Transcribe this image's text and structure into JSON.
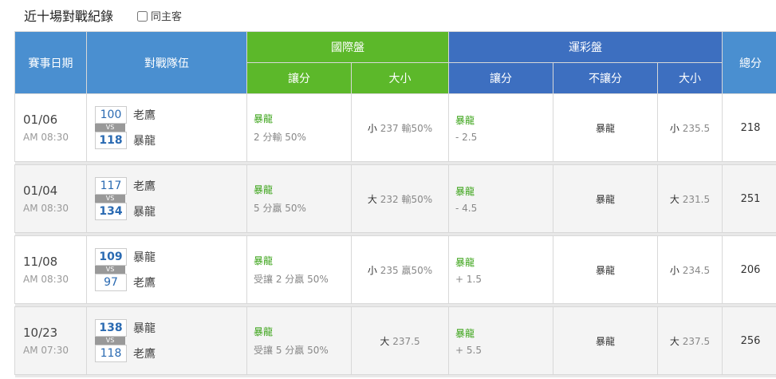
{
  "header": {
    "title": "近十場對戰紀錄",
    "checkbox_label": "同主客"
  },
  "columns": {
    "date": "賽事日期",
    "teams": "對戰隊伍",
    "intl": "國際盤",
    "lottery": "運彩盤",
    "total": "總分",
    "handicap": "讓分",
    "overunder": "大小",
    "no_handicap": "不讓分"
  },
  "vs_label": "VS",
  "rows": [
    {
      "date": "01/06",
      "time": "AM 08:30",
      "team1_score": "100",
      "team1_name": "老鷹",
      "team2_score": "118",
      "team2_name": "暴龍",
      "intl_team": "暴龍",
      "intl_sub": "2 分輸 50%",
      "intl_ou_k": "小",
      "intl_ou_v": "237  輸50%",
      "lot_team": "暴龍",
      "lot_sub": "- 2.5",
      "no_handicap": "暴龍",
      "lot_ou_k": "小",
      "lot_ou_v": "235.5",
      "total": "218"
    },
    {
      "date": "01/04",
      "time": "AM 08:30",
      "team1_score": "117",
      "team1_name": "老鷹",
      "team2_score": "134",
      "team2_name": "暴龍",
      "intl_team": "暴龍",
      "intl_sub": "5 分贏 50%",
      "intl_ou_k": "大",
      "intl_ou_v": "232  輸50%",
      "lot_team": "暴龍",
      "lot_sub": "- 4.5",
      "no_handicap": "暴龍",
      "lot_ou_k": "大",
      "lot_ou_v": "231.5",
      "total": "251"
    },
    {
      "date": "11/08",
      "time": "AM 08:30",
      "team1_score": "109",
      "team1_name": "暴龍",
      "team2_score": "97",
      "team2_name": "老鷹",
      "intl_team": "暴龍",
      "intl_sub": "受讓 2 分贏 50%",
      "intl_ou_k": "小",
      "intl_ou_v": "235  贏50%",
      "lot_team": "暴龍",
      "lot_sub": "+ 1.5",
      "no_handicap": "暴龍",
      "lot_ou_k": "小",
      "lot_ou_v": "234.5",
      "total": "206"
    },
    {
      "date": "10/23",
      "time": "AM 07:30",
      "team1_score": "138",
      "team1_name": "暴龍",
      "team2_score": "118",
      "team2_name": "老鷹",
      "intl_team": "暴龍",
      "intl_sub": "受讓 5 分贏 50%",
      "intl_ou_k": "大",
      "intl_ou_v": "237.5",
      "lot_team": "暴龍",
      "lot_sub": "+ 5.5",
      "no_handicap": "暴龍",
      "lot_ou_k": "大",
      "lot_ou_v": "237.5",
      "total": "256"
    }
  ]
}
